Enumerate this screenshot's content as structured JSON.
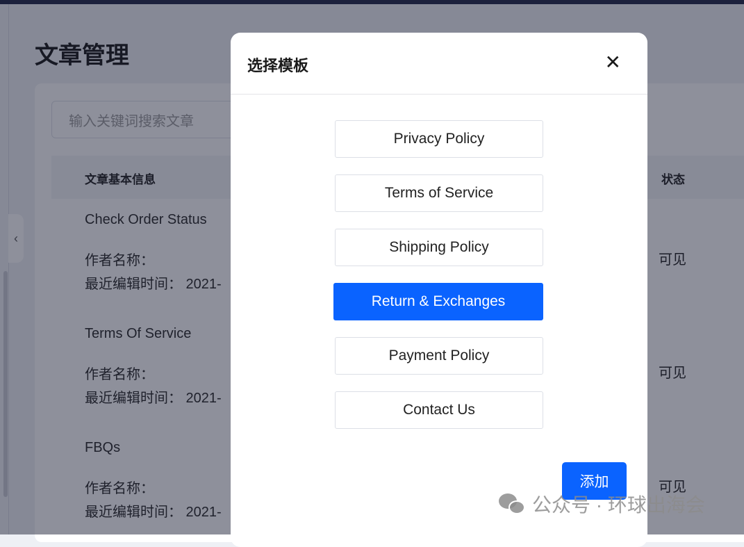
{
  "page": {
    "title": "文章管理",
    "search_placeholder": "输入关键词搜索文章",
    "columns": [
      "文章基本信息",
      "状态"
    ],
    "articles": [
      {
        "name": "Check Order Status",
        "author_label": "作者名称：",
        "edited_label": "最近编辑时间： 2021-",
        "status": "可见"
      },
      {
        "name": "Terms Of Service",
        "author_label": "作者名称：",
        "edited_label": "最近编辑时间： 2021-",
        "status": "可见"
      },
      {
        "name": "FBQs",
        "author_label": "作者名称：",
        "edited_label": "最近编辑时间： 2021-",
        "status": "可见"
      }
    ]
  },
  "modal": {
    "title": "选择模板",
    "close": "✕",
    "options": [
      "Privacy Policy",
      "Terms of Service",
      "Shipping Policy",
      "Return & Exchanges",
      "Payment Policy",
      "Contact Us"
    ],
    "selected": "Return & Exchanges",
    "add_label": "添加"
  },
  "watermark": "公众号 · 环球出海会",
  "colors": {
    "accent": "#0a63ff"
  }
}
